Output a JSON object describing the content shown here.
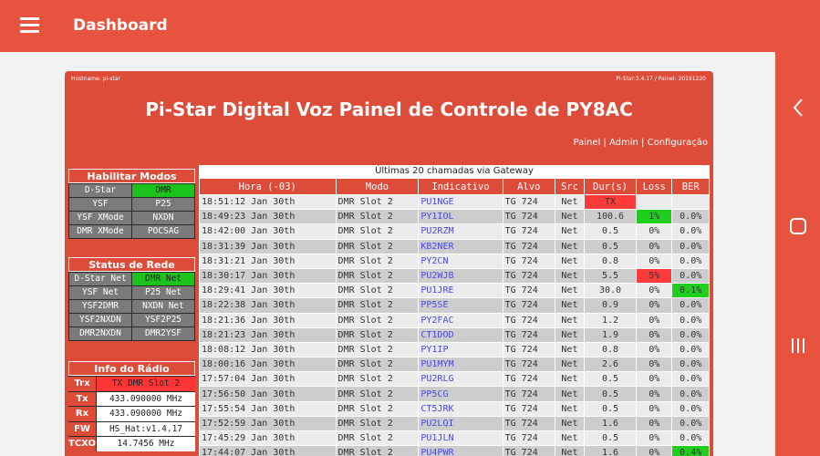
{
  "appbar": {
    "title": "Dashboard",
    "menu_icon": "hamburger-menu-icon"
  },
  "nav": {
    "back_icon": "chevron-left-icon",
    "home_icon": "home-square-icon",
    "recents_icon": "recents-bars-icon"
  },
  "header": {
    "hostname": "Hostname: pi-star",
    "version": "Pi-Star:3.4.17 / Painel: 20191220",
    "title": "Pi-Star Digital Voz Painel de Controle de PY8AC",
    "links": [
      "Painel",
      "Admin",
      "Configuração"
    ],
    "separator": " | "
  },
  "modes": {
    "title": "Habilitar Modos",
    "items": [
      {
        "label": "D-Star",
        "on": false
      },
      {
        "label": "DMR",
        "on": true
      },
      {
        "label": "YSF",
        "on": false
      },
      {
        "label": "P25",
        "on": false
      },
      {
        "label": "YSF XMode",
        "on": false
      },
      {
        "label": "NXDN",
        "on": false
      },
      {
        "label": "DMR XMode",
        "on": false
      },
      {
        "label": "POCSAG",
        "on": false
      }
    ]
  },
  "network": {
    "title": "Status de Rede",
    "items": [
      {
        "label": "D-Star Net",
        "on": false
      },
      {
        "label": "DMR Net",
        "on": true
      },
      {
        "label": "YSF Net",
        "on": false
      },
      {
        "label": "P25 Net",
        "on": false
      },
      {
        "label": "YSF2DMR",
        "on": false
      },
      {
        "label": "NXDN Net",
        "on": false
      },
      {
        "label": "YSF2NXDN",
        "on": false
      },
      {
        "label": "YSF2P25",
        "on": false
      },
      {
        "label": "DMR2NXDN",
        "on": false
      },
      {
        "label": "DMR2YSF",
        "on": false
      }
    ]
  },
  "radio": {
    "title": "Info do Rádio",
    "rows": [
      {
        "key": "Trx",
        "value": "TX DMR Slot 2"
      },
      {
        "key": "Tx",
        "value": "433.090000 MHz"
      },
      {
        "key": "Rx",
        "value": "433.090000 MHz"
      },
      {
        "key": "FW",
        "value": "HS_Hat:v1.4.17"
      },
      {
        "key": "TCXO",
        "value": "14.7456 MHz"
      }
    ]
  },
  "calls": {
    "title": "Últimas 20 chamadas via Gateway",
    "headers": [
      "Hora (-03)",
      "Modo",
      "Indicativo",
      "Alvo",
      "Src",
      "Dur(s)",
      "Loss",
      "BER"
    ],
    "rows": [
      [
        "18:51:12 Jan 30th",
        "DMR Slot 2",
        "PU1NGE",
        "TG 724",
        "Net",
        "TX",
        "",
        ""
      ],
      [
        "18:49:23 Jan 30th",
        "DMR Slot 2",
        "PY1IOL",
        "TG 724",
        "Net",
        "100.6",
        "1%",
        "0.0%"
      ],
      [
        "18:42:00 Jan 30th",
        "DMR Slot 2",
        "PU2RZM",
        "TG 724",
        "Net",
        "0.5",
        "0%",
        "0.0%"
      ],
      [
        "18:31:39 Jan 30th",
        "DMR Slot 2",
        "KB2NER",
        "TG 724",
        "Net",
        "0.5",
        "0%",
        "0.0%"
      ],
      [
        "18:31:21 Jan 30th",
        "DMR Slot 2",
        "PY2CN",
        "TG 724",
        "Net",
        "0.8",
        "0%",
        "0.0%"
      ],
      [
        "18:30:17 Jan 30th",
        "DMR Slot 2",
        "PU2WJB",
        "TG 724",
        "Net",
        "5.5",
        "5%",
        "0.0%"
      ],
      [
        "18:29:41 Jan 30th",
        "DMR Slot 2",
        "PU1JRE",
        "TG 724",
        "Net",
        "30.0",
        "0%",
        "0.1%"
      ],
      [
        "18:22:38 Jan 30th",
        "DMR Slot 2",
        "PP5SE",
        "TG 724",
        "Net",
        "0.9",
        "0%",
        "0.0%"
      ],
      [
        "18:21:36 Jan 30th",
        "DMR Slot 2",
        "PY2FAC",
        "TG 724",
        "Net",
        "1.2",
        "0%",
        "0.0%"
      ],
      [
        "18:21:23 Jan 30th",
        "DMR Slot 2",
        "CT1DOD",
        "TG 724",
        "Net",
        "1.9",
        "0%",
        "0.0%"
      ],
      [
        "18:08:12 Jan 30th",
        "DMR Slot 2",
        "PY1IP",
        "TG 724",
        "Net",
        "0.8",
        "0%",
        "0.0%"
      ],
      [
        "18:00:16 Jan 30th",
        "DMR Slot 2",
        "PU1MYM",
        "TG 724",
        "Net",
        "2.6",
        "0%",
        "0.0%"
      ],
      [
        "17:57:04 Jan 30th",
        "DMR Slot 2",
        "PU2RLG",
        "TG 724",
        "Net",
        "0.5",
        "0%",
        "0.0%"
      ],
      [
        "17:56:50 Jan 30th",
        "DMR Slot 2",
        "PP5CG",
        "TG 724",
        "Net",
        "0.5",
        "0%",
        "0.0%"
      ],
      [
        "17:55:54 Jan 30th",
        "DMR Slot 2",
        "CT5JRK",
        "TG 724",
        "Net",
        "0.5",
        "0%",
        "0.0%"
      ],
      [
        "17:52:59 Jan 30th",
        "DMR Slot 2",
        "PU2LQI",
        "TG 724",
        "Net",
        "1.6",
        "0%",
        "0.0%"
      ],
      [
        "17:45:29 Jan 30th",
        "DMR Slot 2",
        "PU1JLN",
        "TG 724",
        "Net",
        "0.5",
        "0%",
        "0.0%"
      ],
      [
        "17:44:07 Jan 30th",
        "DMR Slot 2",
        "PU4PWR",
        "TG 724",
        "Net",
        "1.6",
        "0%",
        "0.4%"
      ]
    ],
    "highlights": {
      "tx_row": 0,
      "red_loss_rows": [
        5
      ],
      "green_loss_rows": [
        1
      ],
      "green_ber_rows": [
        6,
        17
      ]
    }
  },
  "colors": {
    "accent": "#dd4b39",
    "on": "#1cc21c",
    "alert": "#ff3434",
    "link": "#4a4ae0"
  }
}
